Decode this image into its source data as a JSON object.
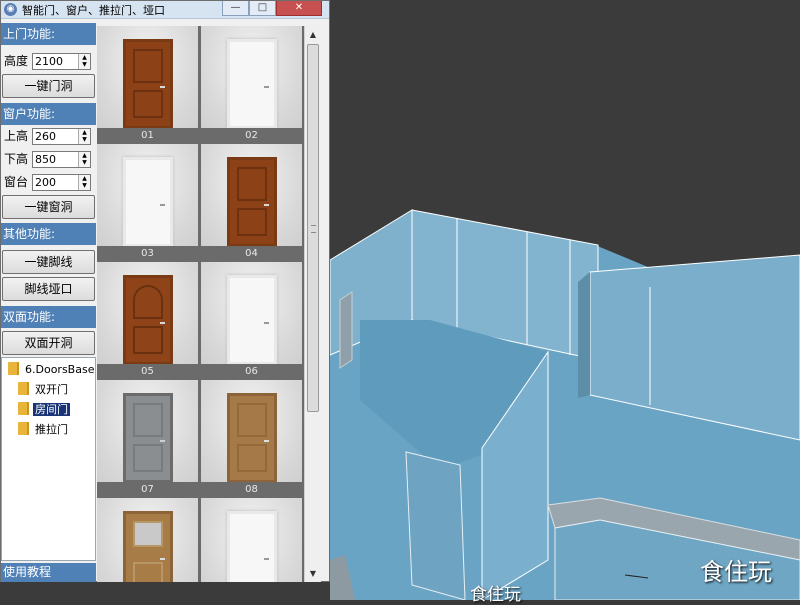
{
  "window": {
    "title": "智能门、窗户、推拉门、垭口",
    "controls": {
      "minimize": "—",
      "maximize": "□",
      "close": "✕"
    }
  },
  "panel": {
    "door_section": {
      "header": "上门功能:",
      "height_label": "高度",
      "height_value": "2100",
      "button": "一键门洞"
    },
    "window_section": {
      "header": "窗户功能:",
      "top_label": "上高",
      "top_value": "260",
      "bottom_label": "下高",
      "bottom_value": "850",
      "sill_label": "窗台",
      "sill_value": "200",
      "button": "一键窗洞"
    },
    "other_section": {
      "header": "其他功能:",
      "baseboard_button": "一键脚线",
      "baseboard_opening_button": "脚线垭口"
    },
    "double_section": {
      "header": "双面功能:",
      "button": "双面开洞"
    },
    "tree": {
      "root": "6.DoorsBase",
      "children": [
        {
          "label": "双开门",
          "selected": false
        },
        {
          "label": "房间门",
          "selected": true
        },
        {
          "label": "推拉门",
          "selected": false
        }
      ]
    },
    "tutorial": "使用教程"
  },
  "thumbnails": [
    {
      "caption": "01",
      "style": "wood-dark"
    },
    {
      "caption": "02",
      "style": "white"
    },
    {
      "caption": "03",
      "style": "white"
    },
    {
      "caption": "04",
      "style": "wood-dark"
    },
    {
      "caption": "05",
      "style": "wood-arch"
    },
    {
      "caption": "06",
      "style": "white"
    },
    {
      "caption": "07",
      "style": "gray"
    },
    {
      "caption": "08",
      "style": "wood-light"
    },
    {
      "caption": "",
      "style": "wood-light-window"
    },
    {
      "caption": "",
      "style": "white"
    }
  ],
  "colors": {
    "section_header": "#4f80b6",
    "wall_face": "#7fb1cc",
    "floor": "#6aa4c4",
    "selection": "#1a3577"
  },
  "watermarks": {
    "right": "食住玩",
    "bottom": "食住玩"
  }
}
